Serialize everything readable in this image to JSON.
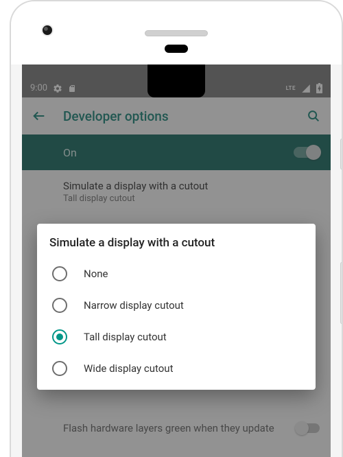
{
  "colors": {
    "accent": "#009688",
    "accent_dark": "#00796b",
    "band": "#005b51"
  },
  "statusbar": {
    "time": "9:00",
    "icons_left": [
      "settings-icon",
      "sd-card-icon"
    ],
    "icons_right_label": "LTE"
  },
  "appbar": {
    "title": "Developer options"
  },
  "master_toggle": {
    "label": "On",
    "enabled": true
  },
  "current_setting": {
    "title": "Simulate a display with a cutout",
    "subtitle": "Tall display cutout"
  },
  "bg_setting": {
    "title": "Flash hardware layers green when they update"
  },
  "dialog": {
    "title": "Simulate a display with a cutout",
    "options": [
      {
        "label": "None",
        "selected": false
      },
      {
        "label": "Narrow display cutout",
        "selected": false
      },
      {
        "label": "Tall display cutout",
        "selected": true
      },
      {
        "label": "Wide display cutout",
        "selected": false
      }
    ]
  }
}
